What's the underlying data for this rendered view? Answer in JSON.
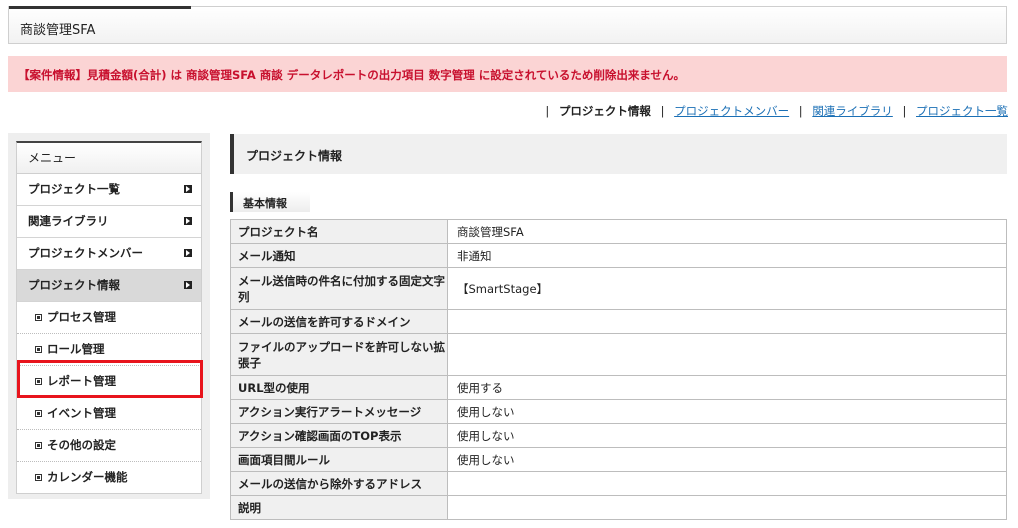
{
  "header": {
    "title": "商談管理SFA"
  },
  "error_message": "【案件情報】見積金額(合計) は 商談管理SFA 商談 データレポートの出力項目 数字管理 に設定されているため削除出来ません。",
  "subnav": {
    "active": "プロジェクト情報",
    "links": [
      "プロジェクトメンバー",
      "関連ライブラリ",
      "プロジェクト一覧"
    ],
    "separator": "|"
  },
  "sidebar": {
    "heading": "メニュー",
    "items": [
      {
        "label": "プロジェクト一覧"
      },
      {
        "label": "関連ライブラリ"
      },
      {
        "label": "プロジェクトメンバー"
      },
      {
        "label": "プロジェクト情報"
      }
    ],
    "sub_items": [
      {
        "label": "プロセス管理"
      },
      {
        "label": "ロール管理"
      },
      {
        "label": "レポート管理"
      },
      {
        "label": "イベント管理"
      },
      {
        "label": "その他の設定"
      },
      {
        "label": "カレンダー機能"
      }
    ]
  },
  "main": {
    "title": "プロジェクト情報",
    "section": "基本情報",
    "rows": [
      {
        "label": "プロジェクト名",
        "value": "商談管理SFA"
      },
      {
        "label": "メール通知",
        "value": "非通知"
      },
      {
        "label": "メール送信時の件名に付加する固定文字列",
        "value": "【SmartStage】"
      },
      {
        "label": "メールの送信を許可するドメイン",
        "value": ""
      },
      {
        "label": "ファイルのアップロードを許可しない拡張子",
        "value": ""
      },
      {
        "label": "URL型の使用",
        "value": "使用する"
      },
      {
        "label": "アクション実行アラートメッセージ",
        "value": "使用しない"
      },
      {
        "label": "アクション確認画面のTOP表示",
        "value": "使用しない"
      },
      {
        "label": "画面項目間ルール",
        "value": "使用しない"
      },
      {
        "label": "メールの送信から除外するアドレス",
        "value": ""
      },
      {
        "label": "説明",
        "value": ""
      }
    ]
  },
  "colors": {
    "error_text": "#c8102e",
    "error_bg": "#fbd4d4",
    "link": "#1a6fb5",
    "highlight_border": "#e8141c"
  }
}
